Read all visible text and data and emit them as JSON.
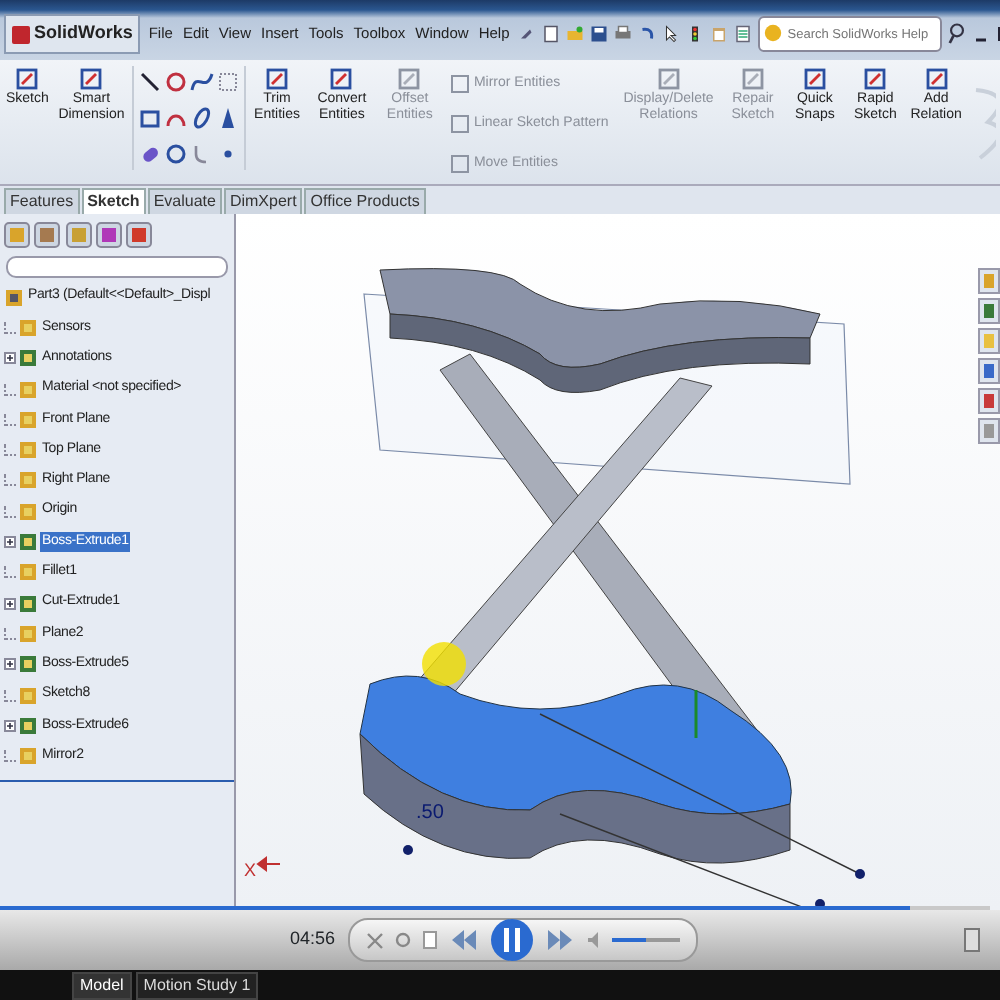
{
  "app": {
    "logo": "SolidWorks"
  },
  "menu": [
    "File",
    "Edit",
    "View",
    "Insert",
    "Tools",
    "Toolbox",
    "Window",
    "Help"
  ],
  "search": {
    "placeholder": "Search SolidWorks Help"
  },
  "ribbon": [
    {
      "kind": "large",
      "label": "Sketch",
      "disabled": false
    },
    {
      "kind": "large",
      "label": "Smart Dimension",
      "disabled": false
    },
    {
      "kind": "tools"
    },
    {
      "kind": "large",
      "label": "Trim Entities",
      "disabled": false
    },
    {
      "kind": "large",
      "label": "Convert Entities",
      "disabled": false
    },
    {
      "kind": "large",
      "label": "Offset Entities",
      "disabled": true
    },
    {
      "kind": "stack",
      "items": [
        {
          "label": "Mirror Entities",
          "disabled": true
        },
        {
          "label": "Linear Sketch Pattern",
          "disabled": true
        },
        {
          "label": "Move Entities",
          "disabled": true
        }
      ]
    },
    {
      "kind": "large",
      "label": "Display/Delete Relations",
      "disabled": true
    },
    {
      "kind": "large",
      "label": "Repair Sketch",
      "disabled": true
    },
    {
      "kind": "large",
      "label": "Quick Snaps",
      "disabled": false
    },
    {
      "kind": "large",
      "label": "Rapid Sketch",
      "disabled": false
    },
    {
      "kind": "large",
      "label": "Add Relation",
      "disabled": false
    }
  ],
  "command_tabs": [
    {
      "label": "Features",
      "selected": false
    },
    {
      "label": "Sketch",
      "selected": true
    },
    {
      "label": "Evaluate",
      "selected": false
    },
    {
      "label": "DimXpert",
      "selected": false
    },
    {
      "label": "Office Products",
      "selected": false
    }
  ],
  "tree": {
    "root": "Part3  (Default<<Default>_Displ",
    "items": [
      {
        "label": "Sensors",
        "kind": "leaf",
        "selected": false
      },
      {
        "label": "Annotations",
        "kind": "collapsed",
        "selected": false
      },
      {
        "label": "Material <not specified>",
        "kind": "leaf",
        "selected": false
      },
      {
        "label": "Front Plane",
        "kind": "leaf",
        "selected": false
      },
      {
        "label": "Top Plane",
        "kind": "leaf",
        "selected": false
      },
      {
        "label": "Right Plane",
        "kind": "leaf",
        "selected": false
      },
      {
        "label": "Origin",
        "kind": "leaf",
        "selected": false
      },
      {
        "label": "Boss-Extrude1",
        "kind": "collapsed",
        "selected": true
      },
      {
        "label": "Fillet1",
        "kind": "leaf",
        "selected": false
      },
      {
        "label": "Cut-Extrude1",
        "kind": "collapsed",
        "selected": false
      },
      {
        "label": "Plane2",
        "kind": "leaf",
        "selected": false
      },
      {
        "label": "Boss-Extrude5",
        "kind": "collapsed",
        "selected": false
      },
      {
        "label": "Sketch8",
        "kind": "leaf",
        "selected": false
      },
      {
        "label": "Boss-Extrude6",
        "kind": "collapsed",
        "selected": false
      },
      {
        "label": "Mirror2",
        "kind": "leaf",
        "selected": false
      }
    ]
  },
  "viewport": {
    "dimension": ".50",
    "axis_label": "X"
  },
  "player": {
    "time": "04:56",
    "progress": {
      "level": 0.92
    },
    "volume": {
      "level": 0.5
    }
  },
  "bottom_tabs": [
    {
      "label": "Model",
      "selected": true
    },
    {
      "label": "Motion Study 1",
      "selected": false
    }
  ]
}
